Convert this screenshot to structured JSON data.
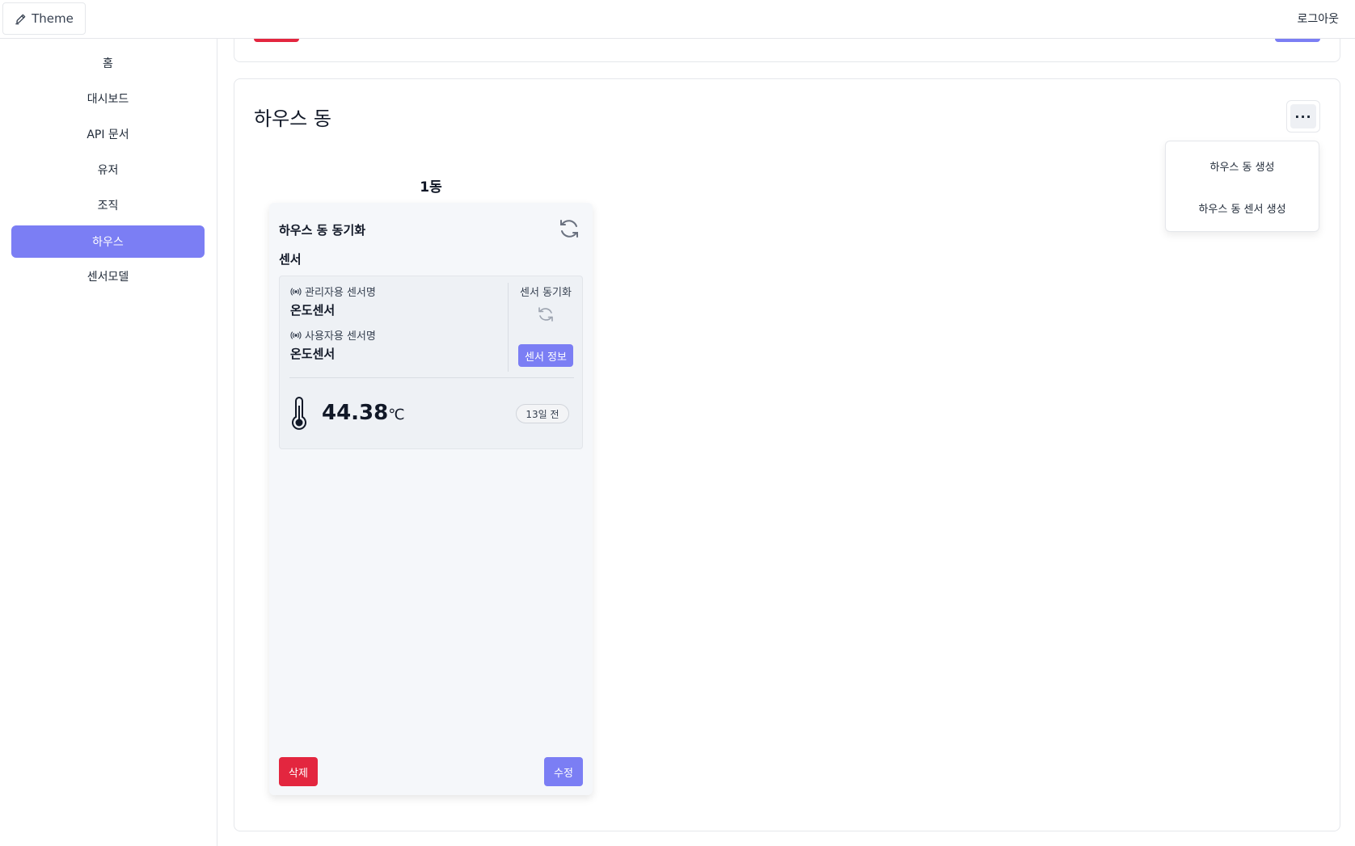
{
  "topbar": {
    "theme_label": "Theme",
    "logout_label": "로그아웃"
  },
  "sidebar": {
    "items": [
      {
        "label": "홈",
        "active": false
      },
      {
        "label": "대시보드",
        "active": false
      },
      {
        "label": "API 문서",
        "active": false
      },
      {
        "label": "유저",
        "active": false
      },
      {
        "label": "조직",
        "active": false
      },
      {
        "label": "하우스",
        "active": true
      },
      {
        "label": "센서모델",
        "active": false
      }
    ]
  },
  "colors": {
    "accent": "#7b7ef4",
    "danger": "#e3263f"
  },
  "section": {
    "title": "하우스 동",
    "more_label": "···",
    "menu": {
      "create_dong": "하우스 동 생성",
      "create_sensor": "하우스 동 센서 생성"
    }
  },
  "dong": {
    "name": "1동",
    "sync_title": "하우스 동 동기화",
    "sensor_heading": "센서",
    "sensor": {
      "admin_name_label": "관리자용 센서명",
      "admin_name": "온도센서",
      "user_name_label": "사용자용 센서명",
      "user_name": "온도센서",
      "sync_label": "센서 동기화",
      "info_label": "센서 정보",
      "value": "44.38",
      "unit": "℃",
      "ago": "13일 전"
    },
    "delete_label": "삭제",
    "edit_label": "수정"
  },
  "icons": [
    "pencil-icon",
    "sync-icon",
    "broadcast-icon",
    "thermometer-icon",
    "more-icon"
  ]
}
